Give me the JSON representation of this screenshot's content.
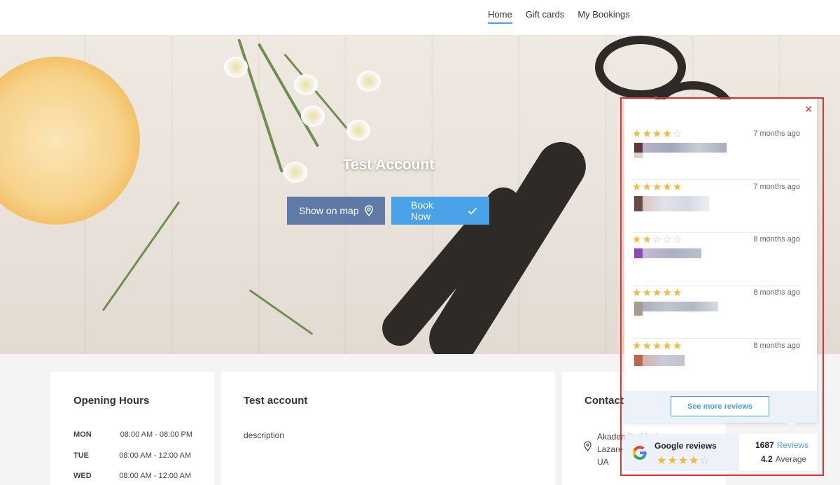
{
  "nav": {
    "items": [
      {
        "label": "Home",
        "active": true
      },
      {
        "label": "Gift cards",
        "active": false
      },
      {
        "label": "My Bookings",
        "active": false
      }
    ]
  },
  "hero": {
    "title": "Test Account",
    "show_on_map": "Show on map",
    "book_now": "Book Now"
  },
  "opening_hours": {
    "title": "Opening Hours",
    "rows": [
      {
        "day": "MON",
        "time": "08:00 AM - 08:00 PM"
      },
      {
        "day": "TUE",
        "time": "08:00 AM - 12:00 AM"
      },
      {
        "day": "WED",
        "time": "08:00 AM - 12:00 AM"
      }
    ]
  },
  "about": {
    "title": "Test account",
    "description": "description"
  },
  "contact": {
    "title": "Contact",
    "address_lines": [
      "Akademika Yanhena",
      "Lazare",
      "UA"
    ]
  },
  "reviews_popup": {
    "close_glyph": "✕",
    "reviews": [
      {
        "stars": 4,
        "ago": "7 months ago"
      },
      {
        "stars": 5,
        "ago": "7 months ago"
      },
      {
        "stars": 2,
        "ago": "8 months ago"
      },
      {
        "stars": 5,
        "ago": "8 months ago"
      },
      {
        "stars": 5,
        "ago": "8 months ago"
      }
    ],
    "see_more": "See more reviews"
  },
  "badge": {
    "name": "Google reviews",
    "stars": 4,
    "count": "1687",
    "count_label": "Reviews",
    "average": "4.2",
    "average_label": "Average"
  },
  "colors": {
    "accent": "#4aa3e8",
    "map_button": "#5f7aa7",
    "star": "#f4b93a",
    "frame": "#e33232"
  },
  "icons": [
    "map-pin-icon",
    "check-icon",
    "close-icon",
    "google-logo-icon",
    "star-icon",
    "location-icon"
  ]
}
